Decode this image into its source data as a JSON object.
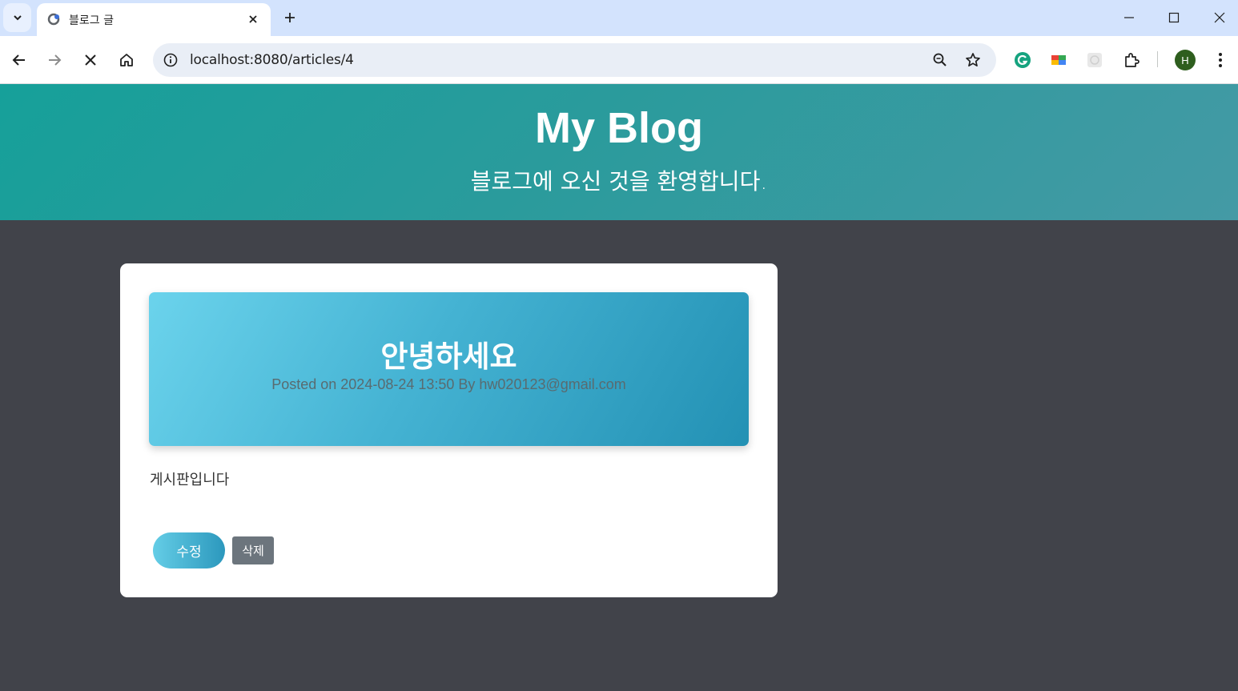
{
  "browser": {
    "tab_title": "블로그 글",
    "url": "localhost:8080/articles/4",
    "profile_initial": "H",
    "icons": [
      "tab-search-icon",
      "favicon-icon",
      "close-icon",
      "plus-icon",
      "minimize-icon",
      "maximize-icon",
      "close-window-icon",
      "back-icon",
      "forward-icon",
      "stop-icon",
      "home-icon",
      "site-info-icon",
      "zoom-icon",
      "bookmark-star-icon",
      "grammarly-icon",
      "color-extension-icon",
      "extension-generic-icon",
      "extensions-puzzle-icon",
      "menu-kebab-icon"
    ]
  },
  "header": {
    "title": "My Blog",
    "subtitle": "블로그에 오신 것을 환영합니다."
  },
  "article": {
    "title": "안녕하세요",
    "meta": "Posted on 2024-08-24 13:50 By hw020123@gmail.com",
    "content": "게시판입니다",
    "edit_label": "수정",
    "delete_label": "삭제"
  },
  "colors": {
    "hero_gradient": [
      "#16a09a",
      "#449aa5"
    ],
    "article_head_gradient": [
      "#6bd3ec",
      "#2391b4"
    ],
    "page_background": "#41434a",
    "delete_button": "#6c757d"
  }
}
